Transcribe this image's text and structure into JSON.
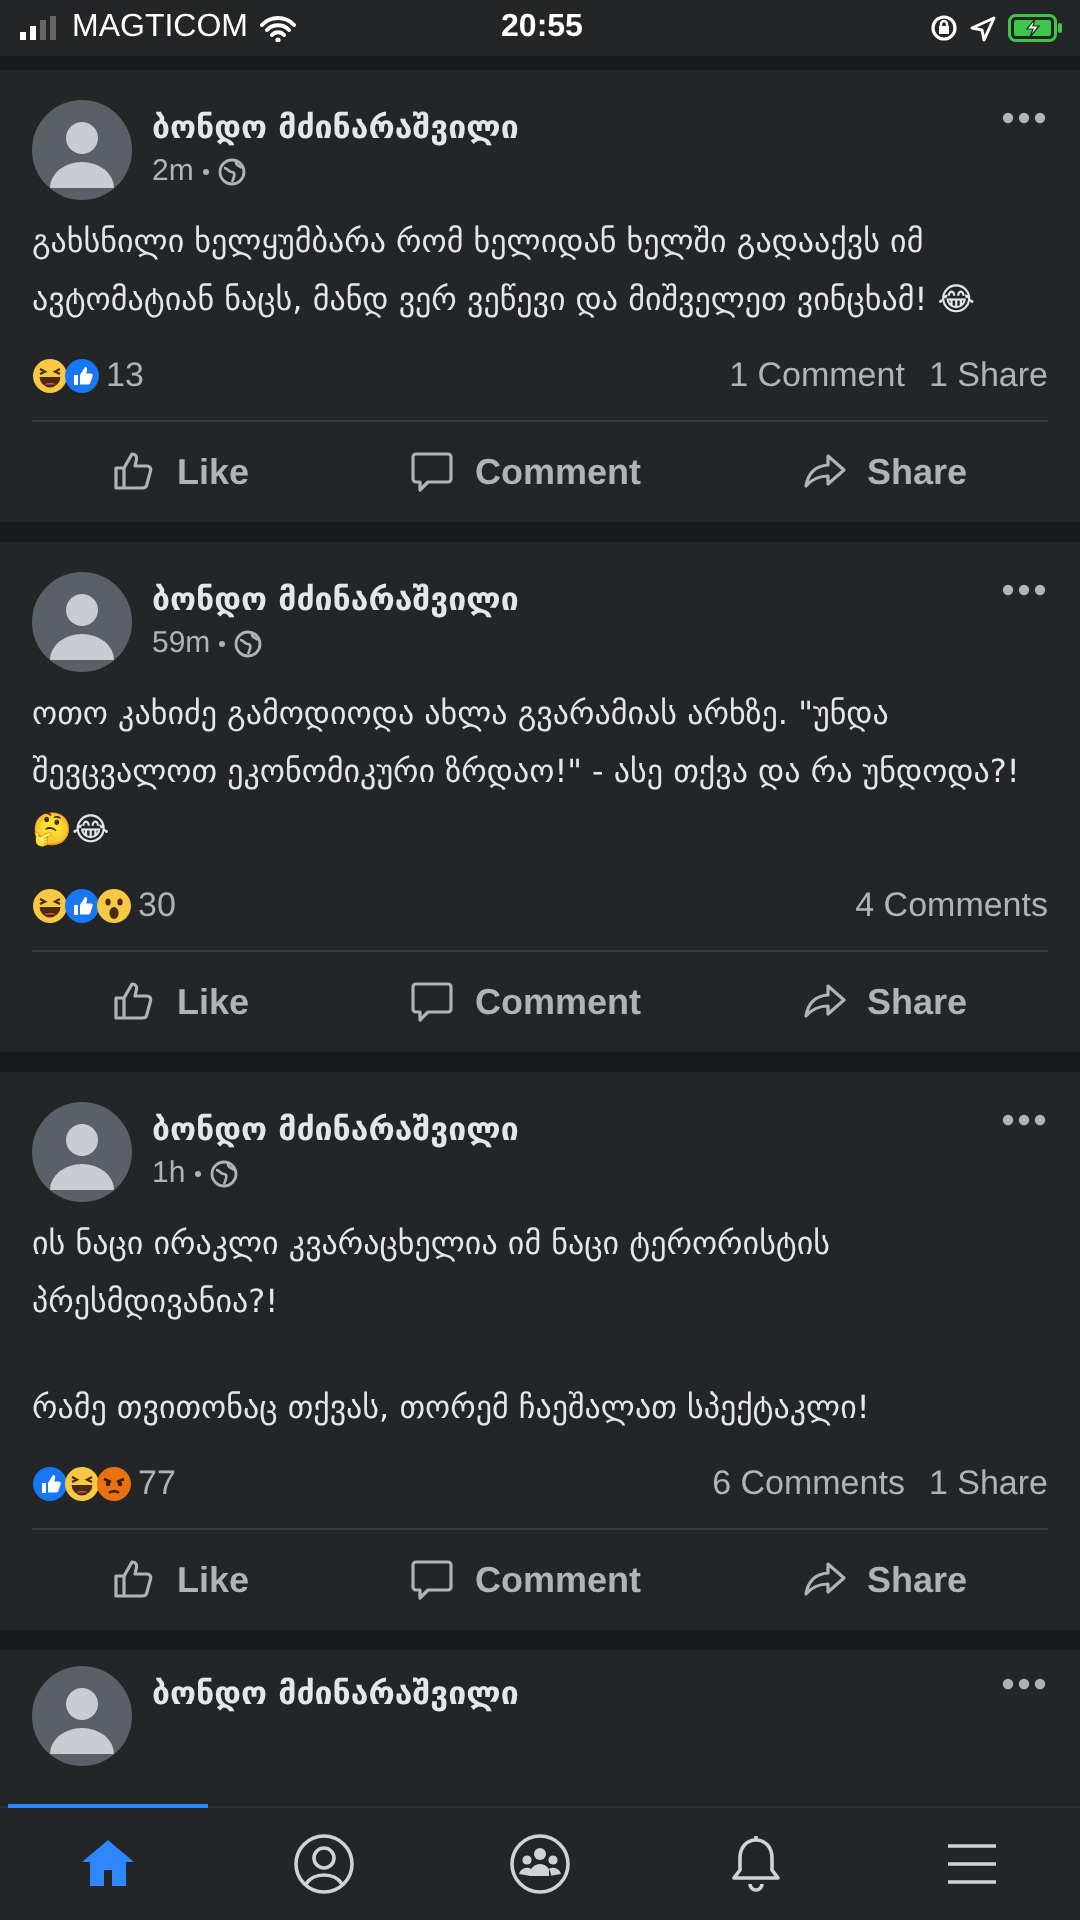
{
  "status_bar": {
    "carrier": "MAGTICOM",
    "time": "20:55"
  },
  "posts": [
    {
      "author": "ბონდო მძინარაშვილი",
      "time": "2m",
      "paragraphs": [
        "გახსნილი ხელყუმბარა რომ ხელიდან ხელში გადააქვს იმ ავტომატიან ნაცს, მანდ ვერ ვეწევი და მიშველეთ ვინცხამ! 😂"
      ],
      "reactions": [
        {
          "kind": "haha"
        },
        {
          "kind": "like"
        }
      ],
      "reaction_count": "13",
      "comments": "1 Comment",
      "shares": "1 Share",
      "actions": [
        "Like",
        "Comment",
        "Share"
      ]
    },
    {
      "author": "ბონდო მძინარაშვილი",
      "time": "59m",
      "paragraphs": [
        "ოთო კახიძე გამოდიოდა ახლა გვარამიას არხზე. \"უნდა შევცვალოთ ეკონომიკური ზრდაო!\" - ასე თქვა და რა უნდოდა?! 🤔😂"
      ],
      "reactions": [
        {
          "kind": "haha"
        },
        {
          "kind": "like"
        },
        {
          "kind": "wow"
        }
      ],
      "reaction_count": "30",
      "comments": "4 Comments",
      "actions": [
        "Like",
        "Comment",
        "Share"
      ]
    },
    {
      "author": "ბონდო მძინარაშვილი",
      "time": "1h",
      "paragraphs": [
        "ის ნაცი ირაკლი კვარაცხელია იმ ნაცი ტერორისტის პრესმდივანია?!",
        "რამე თვითონაც თქვას, თორემ ჩაეშალათ სპექტაკლი!"
      ],
      "reactions": [
        {
          "kind": "like"
        },
        {
          "kind": "haha"
        },
        {
          "kind": "angry"
        }
      ],
      "reaction_count": "77",
      "comments": "6 Comments",
      "shares": "1 Share",
      "actions": [
        "Like",
        "Comment",
        "Share"
      ]
    },
    {
      "author": "ბონდო მძინარაშვილი"
    }
  ],
  "tab_bar": [
    {
      "kind": "home",
      "selected": true
    },
    {
      "kind": "profile",
      "selected": false
    },
    {
      "kind": "groups",
      "selected": false
    },
    {
      "kind": "notifications",
      "selected": false
    },
    {
      "kind": "menu",
      "selected": false
    }
  ]
}
